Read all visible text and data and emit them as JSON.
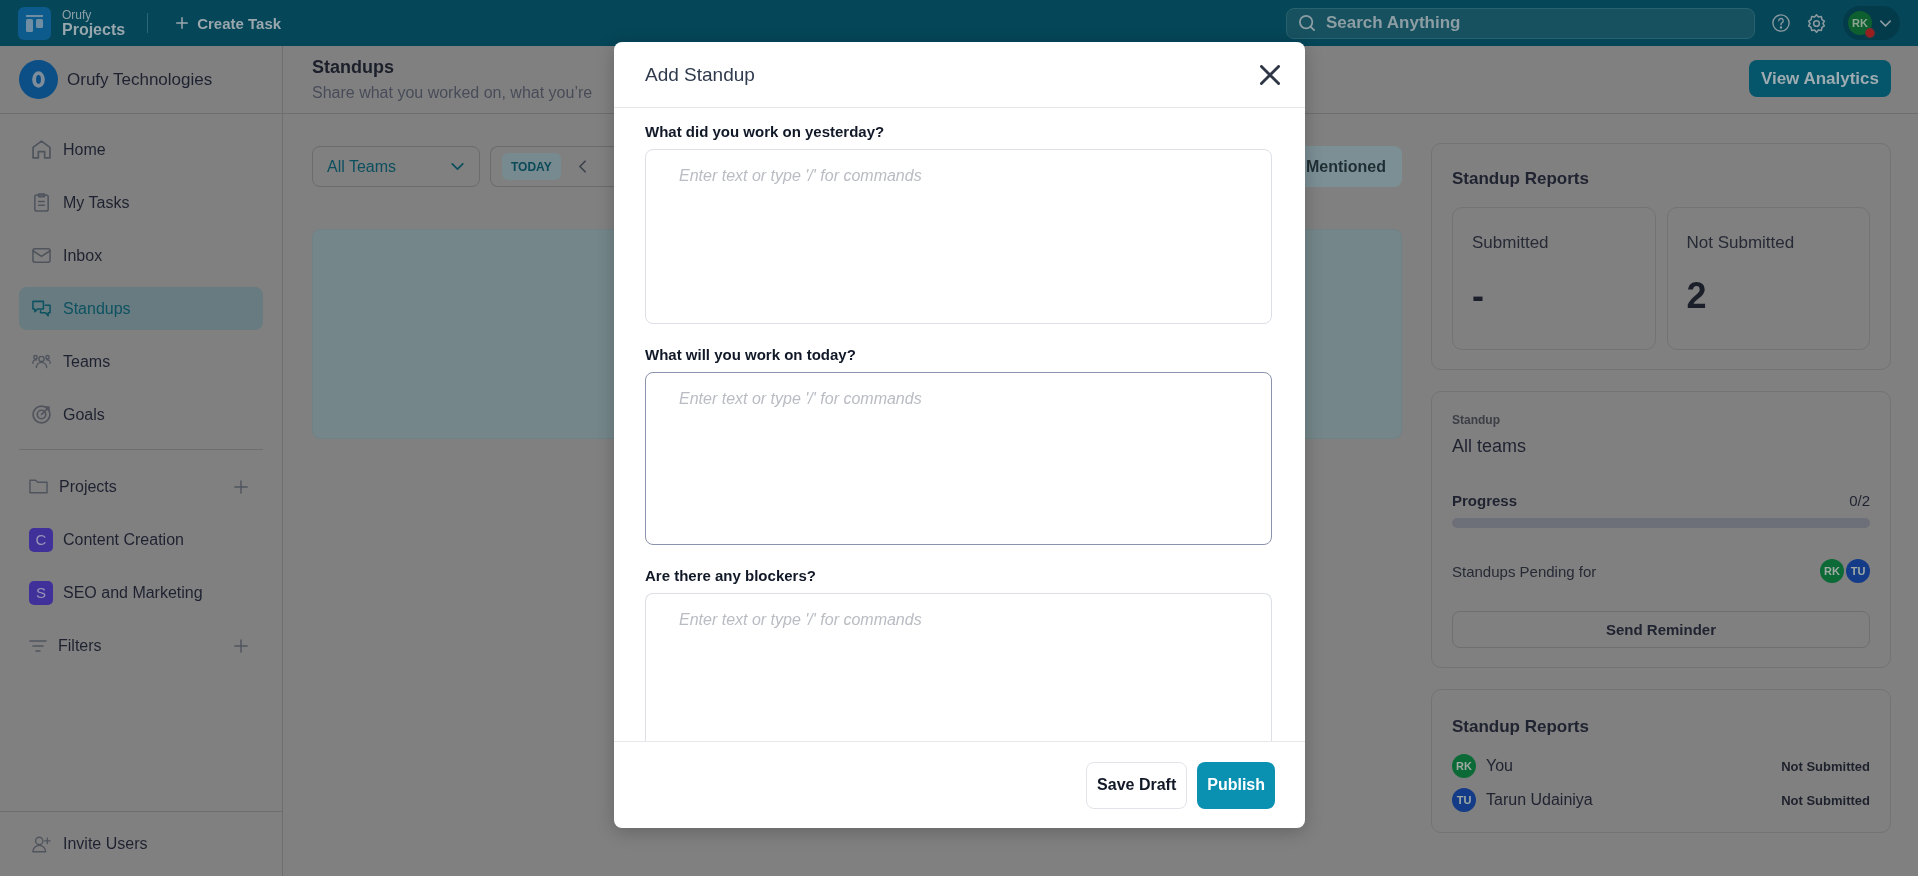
{
  "top_bar": {
    "brand": "Orufy",
    "product": "Projects",
    "create_task": "Create Task",
    "search": {
      "placeholder": "Search Anything"
    },
    "user": {
      "initials": "RK"
    }
  },
  "sidebar": {
    "workspace": "Orufy Technologies",
    "nav": [
      {
        "label": "Home",
        "selected": false
      },
      {
        "label": "My Tasks",
        "selected": false
      },
      {
        "label": "Inbox",
        "selected": false
      },
      {
        "label": "Standups",
        "selected": true
      },
      {
        "label": "Teams",
        "selected": false
      },
      {
        "label": "Goals",
        "selected": false
      }
    ],
    "projects": {
      "label": "Projects",
      "items": [
        {
          "initial": "C",
          "label": "Content Creation"
        },
        {
          "initial": "S",
          "label": "SEO and Marketing"
        }
      ]
    },
    "filters": {
      "label": "Filters"
    },
    "invite": "Invite Users"
  },
  "main": {
    "title": "Standups",
    "subtitle": "Share what you worked on, what you’re",
    "view_analytics": "View Analytics",
    "team_filter": {
      "value": "All Teams"
    },
    "date_nav": {
      "today": "TODAY"
    },
    "tabs": [
      {
        "label": "Mentioned",
        "selected": true
      }
    ]
  },
  "right_panel": {
    "summary": {
      "title": "Standup Reports",
      "stats": [
        {
          "label": "Submitted",
          "value": "-"
        },
        {
          "label": "Not Submitted",
          "value": "2"
        }
      ]
    },
    "standup": {
      "overline": "Standup",
      "title": "All teams",
      "progress": {
        "label": "Progress",
        "reading": "0/2",
        "level": 0
      },
      "pending": {
        "label": "Standups Pending for",
        "avatars": [
          {
            "initials": "RK",
            "color": "#0b6a36"
          },
          {
            "initials": "TU",
            "color": "#143b87"
          }
        ]
      },
      "reminder": "Send Reminder"
    },
    "reports": {
      "title": "Standup Reports",
      "rows": [
        {
          "initials": "RK",
          "color": "#0b6a36",
          "name": "You",
          "status": "Not Submitted"
        },
        {
          "initials": "TU",
          "color": "#143b87",
          "name": "Tarun Udainiya",
          "status": "Not Submitted"
        }
      ]
    }
  },
  "modal": {
    "title": "Add Standup",
    "questions": [
      {
        "label": "What did you work on yesterday?",
        "placeholder": "Enter text or type '/' for commands",
        "focused": false
      },
      {
        "label": "What will you work on today?",
        "placeholder": "Enter text or type '/' for commands",
        "focused": true
      },
      {
        "label": "Are there any blockers?",
        "placeholder": "Enter text or type '/' for commands",
        "focused": false
      }
    ],
    "buttons": [
      {
        "label": "Save Draft",
        "kind": "secondary"
      },
      {
        "label": "Publish",
        "kind": "primary"
      }
    ]
  }
}
